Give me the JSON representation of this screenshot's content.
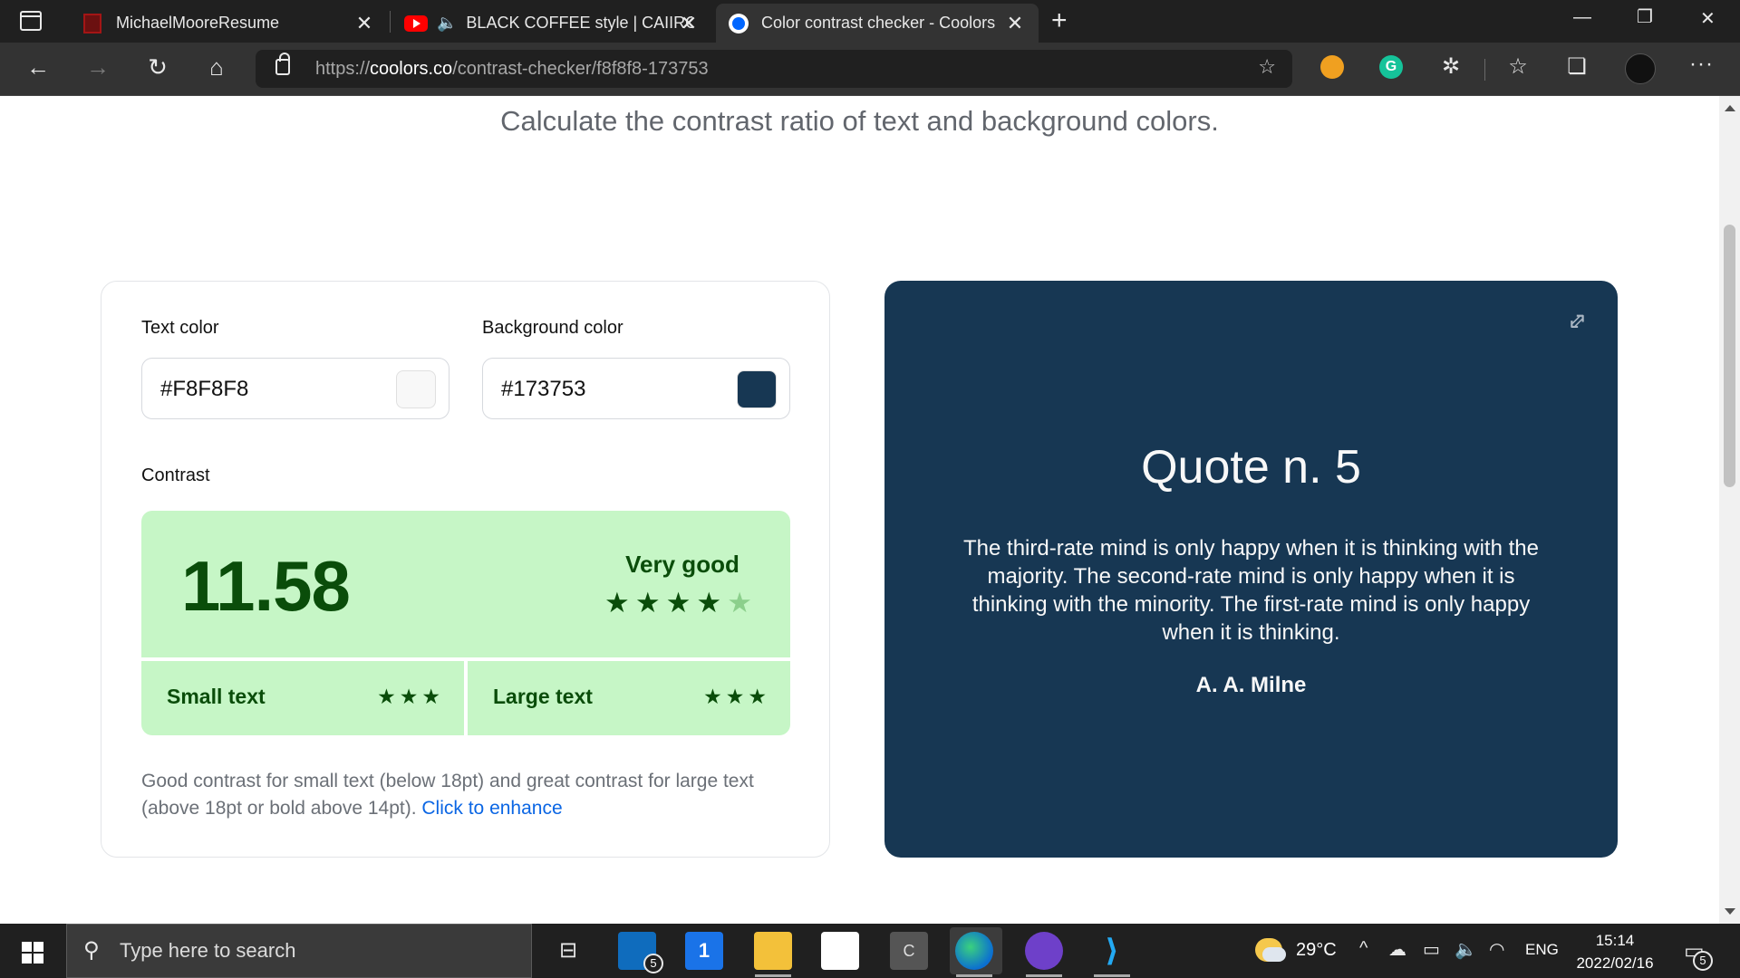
{
  "browser": {
    "tabs": [
      {
        "title": "MichaelMooreResume",
        "active": false
      },
      {
        "title": "BLACK COFFEE style | CAIIRO",
        "active": false,
        "playing_audio": true
      },
      {
        "title": "Color contrast checker - Coolors",
        "active": true
      }
    ],
    "url_prefix": "https://",
    "url_host": "coolors.co",
    "url_path": "/contrast-checker/f8f8f8-173753"
  },
  "page": {
    "subtitle": "Calculate the contrast ratio of text and background colors.",
    "text_color": {
      "label": "Text color",
      "value": "#F8F8F8",
      "swatch": "#f8f8f8"
    },
    "background_color": {
      "label": "Background color",
      "value": "#173753",
      "swatch": "#173753"
    },
    "contrast": {
      "label": "Contrast",
      "ratio": "11.58",
      "rating": "Very good",
      "stars_filled": 4,
      "stars_total": 5,
      "small_text": {
        "label": "Small text",
        "stars": 3
      },
      "large_text": {
        "label": "Large text",
        "stars": 3
      }
    },
    "description": "Good contrast for small text (below 18pt) and great contrast for large text (above 18pt or bold above 14pt).",
    "enhance_link": "Click to enhance",
    "preview": {
      "title": "Quote n. 5",
      "text": "The third-rate mind is only happy when it is thinking with the majority. The second-rate mind is only happy when it is thinking with the minority. The first-rate mind is only happy when it is thinking.",
      "author": "A. A. Milne",
      "background": "#173753",
      "text_color": "#f8f8f8"
    },
    "accent_good": "#c6f6c6",
    "accent_good_text": "#0a4d0a"
  },
  "taskbar": {
    "search_placeholder": "Type here to search",
    "mail_badge": "5",
    "calendar_day": "1",
    "temperature": "29°C",
    "language": "ENG",
    "time": "15:14",
    "date": "2022/02/16",
    "notification_count": "5"
  }
}
